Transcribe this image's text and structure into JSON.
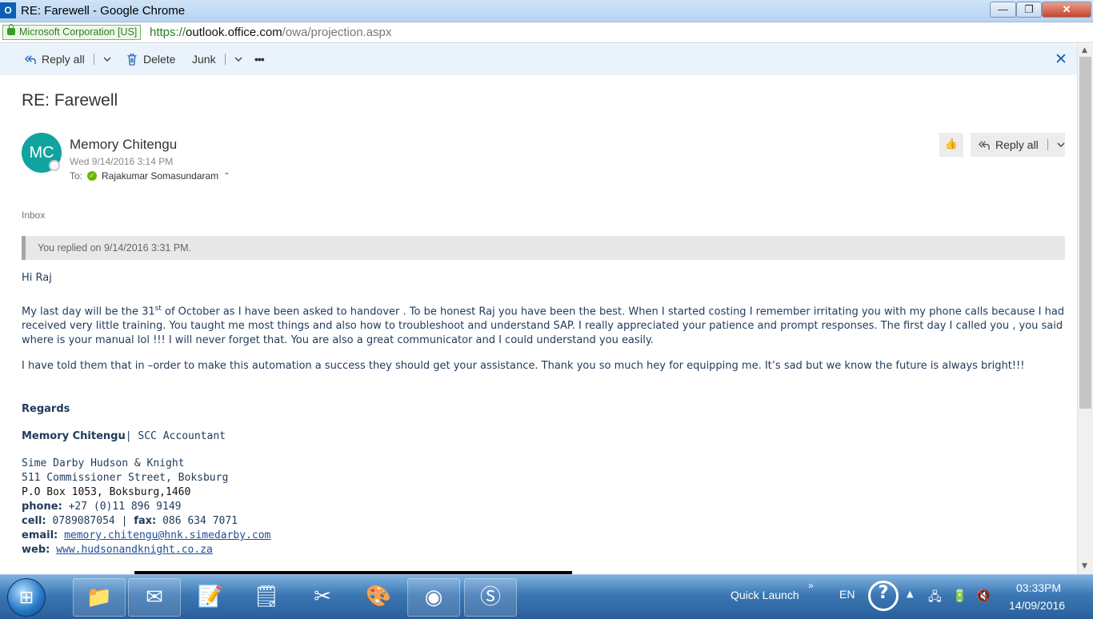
{
  "window": {
    "title": "RE: Farewell - Google Chrome",
    "app_icon": "O",
    "minimize": "—",
    "maximize": "❐",
    "close": "✕"
  },
  "address_bar": {
    "ev_label": "Microsoft Corporation [US]",
    "url_protocol": "https://",
    "url_host": "outlook.office.com",
    "url_path": "/owa/projection.aspx"
  },
  "toolbar": {
    "reply_all": "Reply all",
    "delete": "Delete",
    "junk": "Junk",
    "more": "•••"
  },
  "message": {
    "subject": "RE: Farewell",
    "avatar_initials": "MC",
    "sender": "Memory Chitengu",
    "date": "Wed 9/14/2016 3:14 PM",
    "to_label": "To:",
    "recipient": "Rajakumar Somasundaram",
    "reply_all_button": "Reply all",
    "folder": "Inbox",
    "replied_notice": "You replied on 9/14/2016 3:31 PM.",
    "greeting": "Hi Raj",
    "para1_start": "My last day will be the 31",
    "para1_sup": "st",
    "para1_rest": " of October as I have been asked to handover . To be honest Raj you have been the best. When I started costing I remember irritating you with my phone calls because I had received very little training. You taught me most things and also how to troubleshoot and understand SAP. I really appreciated your patience and prompt responses. The first day I called you , you said where is your manual lol !!! I will never forget that. You are also a great communicator and I could understand you easily.",
    "para2": "I have told them that in –order to make this automation a success they should get your assistance. Thank you so much hey for equipping me. It’s sad but we know the future is always bright!!!"
  },
  "signature": {
    "regards": "Regards",
    "name": "Memory Chitengu",
    "title": "| SCC Accountant",
    "company": "Sime Darby Hudson & Knight",
    "street": "511 Commissioner Street, Boksburg",
    "po_box": "P.O Box 1053, Boksburg,1460",
    "phone_label": "phone:",
    "phone": "+27 (0)11 896 9149",
    "cell_label": "cell:",
    "cell": "0789087054",
    "separator": " | ",
    "fax_label": "fax:",
    "fax": "086 634 7071",
    "email_label": "email:",
    "email": "memory.chitengu@hnk.simedarby.com ",
    "web_label": "web:",
    "web": "www.hudsonandknight.co.za"
  },
  "taskbar": {
    "quick_launch": "Quick Launch",
    "language": "EN",
    "time": "03:33PM",
    "date": "14/09/2016"
  },
  "colors": {
    "accent": "#1a5fb4",
    "avatar": "#11a3a0",
    "toolbar_bg": "#eaf3fb"
  }
}
